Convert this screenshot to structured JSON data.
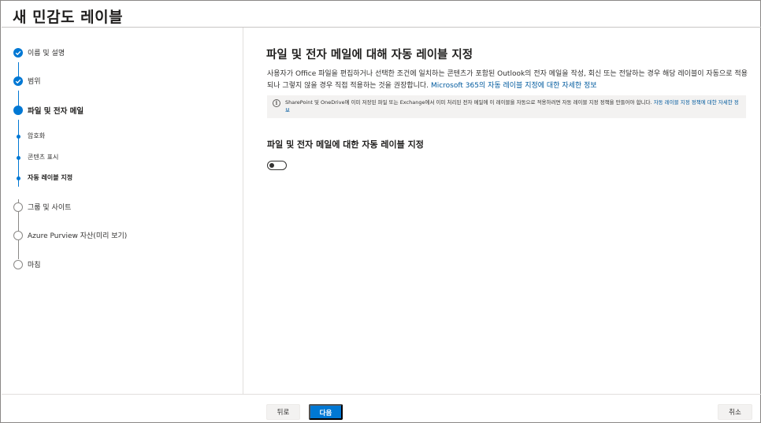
{
  "header": {
    "title": "새 민감도 레이블"
  },
  "steps": [
    {
      "label": "이름 및 설명",
      "state": "done"
    },
    {
      "label": "범위",
      "state": "done"
    },
    {
      "label": "파일 및 전자 메일",
      "state": "current"
    },
    {
      "label": "암호화",
      "state": "substep"
    },
    {
      "label": "콘텐츠 표시",
      "state": "substep"
    },
    {
      "label": "자동 레이블 지정",
      "state": "substep-current"
    },
    {
      "label": "그룹 및 사이트",
      "state": "todo"
    },
    {
      "label": "Azure Purview 자산(미리 보기)",
      "state": "todo"
    },
    {
      "label": "마침",
      "state": "todo"
    }
  ],
  "main": {
    "heading": "파일 및 전자 메일에 대해 자동 레이블 지정",
    "description": "사용자가 Office 파일을 편집하거나 선택한 조건에 일치하는 콘텐츠가 포함된 Outlook의 전자 메일을 작성, 회신 또는 전달하는 경우 해당 레이블이 자동으로 적용되나 그렇지 않을 경우 직접 적용하는 것을 권장합니다.",
    "description_link": "Microsoft 365의 자동 레이블 지정에 대한 자세한 정보",
    "info_text": "SharePoint 및 OneDrive에 이미 저장된 파일 또는 Exchange에서 이미 처리된 전자 메일에 이 레이블을 자동으로 적용하려면 자동 레이블 지정 정책을 만들어야 합니다.",
    "info_link": "자동 레이블 지정 정책에 대한 자세한 정보",
    "section_heading": "파일 및 전자 메일에 대한 자동 레이블 지정",
    "toggle_on": false
  },
  "footer": {
    "back_label": "뒤로",
    "next_label": "다음",
    "cancel_label": "취소"
  },
  "colors": {
    "accent": "#0078d4",
    "link": "#005a9e"
  }
}
